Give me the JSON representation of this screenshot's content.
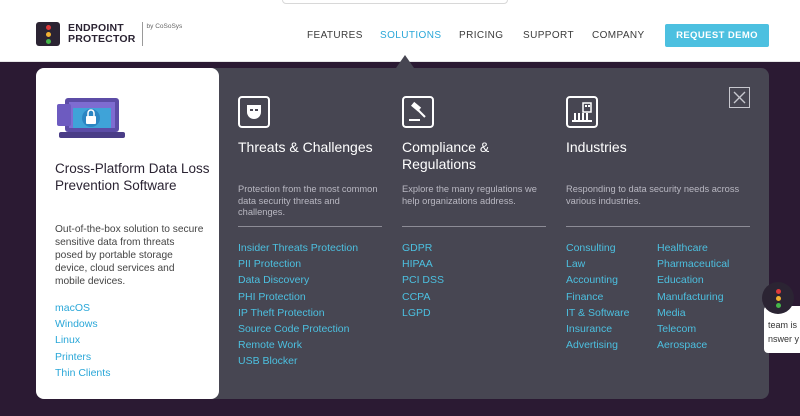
{
  "logo": {
    "line1": "ENDPOINT",
    "line2": "PROTECTOR",
    "by": "by CoSoSys"
  },
  "nav": [
    {
      "label": "FEATURES"
    },
    {
      "label": "SOLUTIONS"
    },
    {
      "label": "PRICING"
    },
    {
      "label": "SUPPORT"
    },
    {
      "label": "COMPANY"
    }
  ],
  "active_nav": "SOLUTIONS",
  "demo_button": "REQUEST DEMO",
  "card": {
    "title": "Cross-Platform Data Loss Prevention Software",
    "desc": "Out-of-the-box solution to secure sensitive data from threats posed by portable storage device, cloud services and mobile devices.",
    "links": [
      "macOS",
      "Windows",
      "Linux",
      "Printers",
      "Thin Clients"
    ]
  },
  "columns": [
    {
      "icon": "mask-icon",
      "title": "Threats & Challenges",
      "desc": "Protection from the most common data security threats and challenges.",
      "links": [
        "Insider Threats Protection",
        "PII Protection",
        "Data Discovery",
        "PHI Protection",
        "IP Theft Protection",
        "Source Code Protection",
        "Remote Work",
        "USB Blocker"
      ]
    },
    {
      "icon": "gavel-icon",
      "title": "Compliance & Regulations",
      "desc": "Explore the many regulations we help organizations address.",
      "links": [
        "GDPR",
        "HIPAA",
        "PCI DSS",
        "CCPA",
        "LGPD"
      ]
    },
    {
      "icon": "industry-icon",
      "title": "Industries",
      "desc": "Responding to data security needs across various industries.",
      "links_left": [
        "Consulting",
        "Law",
        "Accounting",
        "Finance",
        "IT & Software",
        "Insurance",
        "Advertising"
      ],
      "links_right": [
        "Healthcare",
        "Pharmaceutical",
        "Education",
        "Manufacturing",
        "Media",
        "Telecom",
        "Aerospace"
      ]
    }
  ],
  "chat": {
    "line1": "team is",
    "line2": "nswer y"
  },
  "colors": {
    "accent": "#4cc0e0",
    "menu_bg": "#474652",
    "page_bg": "#2b1a33"
  }
}
